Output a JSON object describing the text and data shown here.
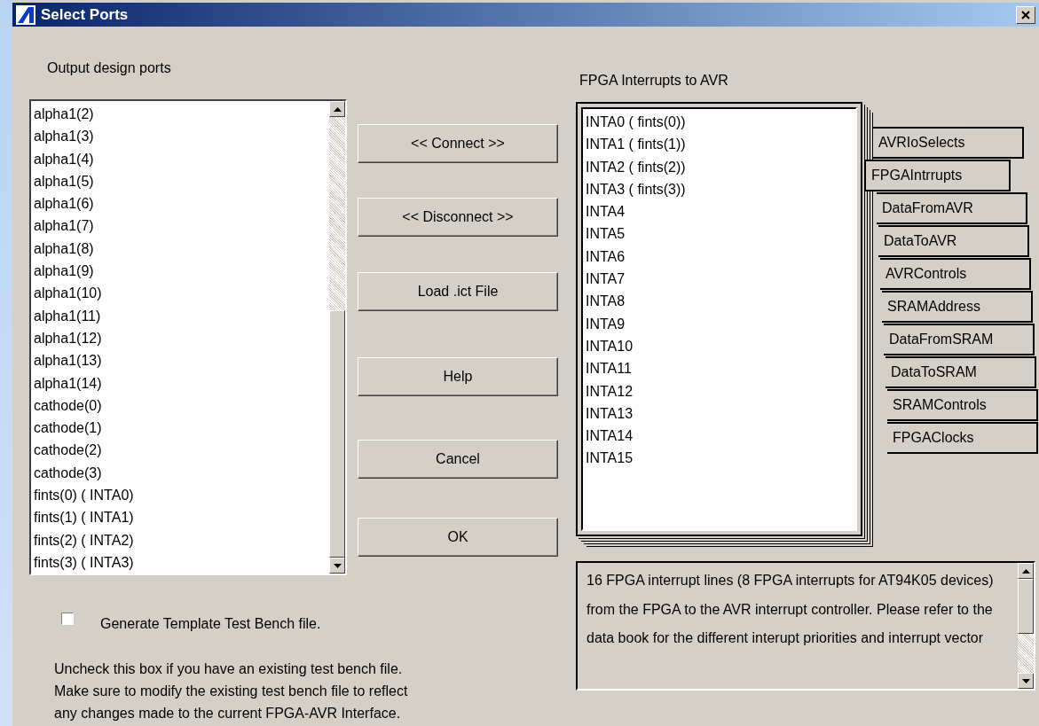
{
  "window": {
    "title": "Select Ports"
  },
  "output_ports": {
    "label": "Output design ports",
    "items": [
      "alpha1(2)",
      "alpha1(3)",
      "alpha1(4)",
      "alpha1(5)",
      "alpha1(6)",
      "alpha1(7)",
      "alpha1(8)",
      "alpha1(9)",
      "alpha1(10)",
      "alpha1(11)",
      "alpha1(12)",
      "alpha1(13)",
      "alpha1(14)",
      "cathode(0)",
      "cathode(1)",
      "cathode(2)",
      "cathode(3)",
      "fints(0) ( INTA0)",
      "fints(1) ( INTA1)",
      "fints(2) ( INTA2)",
      "fints(3) ( INTA3)"
    ]
  },
  "buttons": [
    "<< Connect >>",
    "<< Disconnect >>",
    "Load .ict File",
    "Help",
    "Cancel",
    "OK"
  ],
  "interrupts": {
    "label": "FPGA Interrupts to AVR",
    "items": [
      "INTA0 ( fints(0))",
      "INTA1 ( fints(1))",
      "INTA2 ( fints(2))",
      "INTA3 ( fints(3))",
      "INTA4",
      "INTA5",
      "INTA6",
      "INTA7",
      "INTA8",
      "INTA9",
      "INTA10",
      "INTA11",
      "INTA12",
      "INTA13",
      "INTA14",
      "INTA15"
    ]
  },
  "tabs": [
    {
      "label": "AVRIoSelects",
      "selected": false
    },
    {
      "label": "FPGAIntrrupts",
      "selected": true
    },
    {
      "label": "DataFromAVR",
      "selected": false
    },
    {
      "label": "DataToAVR",
      "selected": false
    },
    {
      "label": "AVRControls",
      "selected": false
    },
    {
      "label": "SRAMAddress",
      "selected": false
    },
    {
      "label": "DataFromSRAM",
      "selected": false
    },
    {
      "label": "DataToSRAM",
      "selected": false
    },
    {
      "label": "SRAMControls",
      "selected": false
    },
    {
      "label": "FPGAClocks",
      "selected": false
    }
  ],
  "test_bench": {
    "label": "Generate Template Test Bench file.",
    "checked": false,
    "note": "Uncheck this box if you have an existing test bench file.  Make sure to  modify the  existing test bench file to reflect any changes made to the current FPGA-AVR Interface."
  },
  "description": "16 FPGA interrupt lines (8 FPGA interrupts for AT94K05 devices) from the FPGA to the AVR interrupt controller. Please refer to the data book for the different interupt priorities and interrupt vector"
}
